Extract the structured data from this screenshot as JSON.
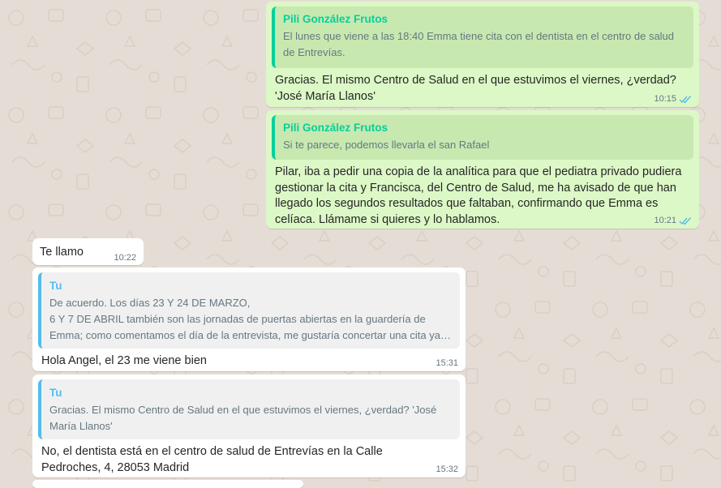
{
  "messages": {
    "m1": {
      "quote_author": "Pili González Frutos",
      "quote_text": "El lunes que viene a las 18:40 Emma tiene cita con el dentista en el centro de salud de Entrevías.",
      "text": "Gracias. El mismo Centro de Salud en el que estuvimos el viernes, ¿verdad?\n'José María Llanos'",
      "time": "10:15"
    },
    "m2": {
      "quote_author": "Pili González Frutos",
      "quote_text": "Si te parece,  podemos llevarla el san Rafael",
      "text": "Pilar, iba a pedir una copia de la analítica para que el pediatra privado pudiera gestionar la cita y Francisca, del Centro de Salud, me ha avisado de que han llegado los segundos resultados que faltaban, confirmando que Emma es celíaca. Llámame si quieres y lo hablamos.",
      "time": "10:21"
    },
    "m3": {
      "text": "Te llamo",
      "time": "10:22"
    },
    "m4": {
      "quote_author": "Tu",
      "quote_line1": "De acuerdo. Los días 23 Y 24  DE MARZO,",
      "quote_line2": "6 Y 7 DE ABRIL también son las jornadas de puertas abiertas en la guardería de",
      "quote_line3": "Emma; como comentamos el día de la entrevista, me gustaría concertar una cita ya …",
      "text": "Hola Angel, el 23 me viene bien",
      "time": "15:31"
    },
    "m5": {
      "quote_author": "Tu",
      "quote_text": "Gracias. El mismo Centro de Salud en el que estuvimos el viernes, ¿verdad? 'José María Llanos'",
      "text": "No, el dentista está en el centro de salud de Entrevías en la Calle Pedroches, 4, 28053 Madrid",
      "time": "15:32"
    }
  },
  "colors": {
    "wallpaper": "#e5ddd5",
    "outgoing": "#dcf8c6",
    "incoming": "#ffffff",
    "read_ticks": "#53bdeb",
    "quote_author_out": "#06cf9c",
    "quote_author_in": "#53bdeb"
  },
  "icons": {
    "read_receipt": "double-check-icon"
  }
}
